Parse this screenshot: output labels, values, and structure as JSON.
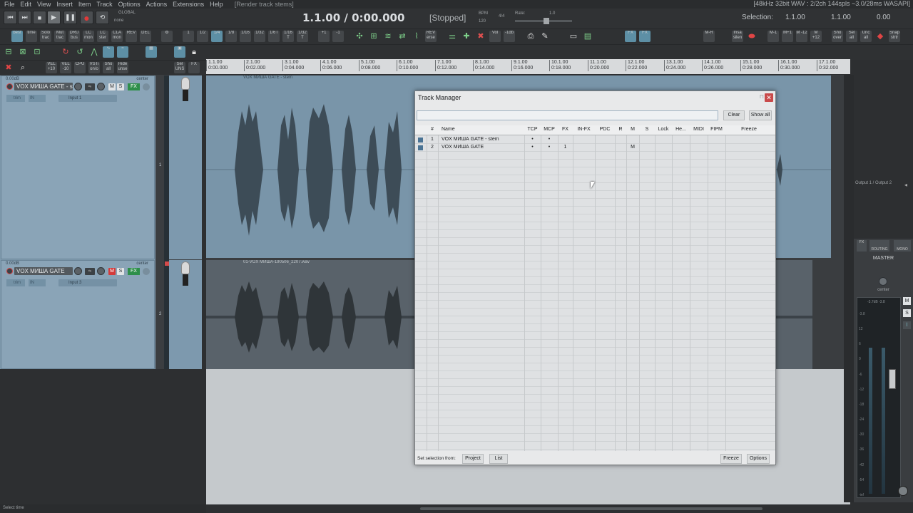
{
  "menubar": {
    "items": [
      "File",
      "Edit",
      "View",
      "Insert",
      "Item",
      "Track",
      "Options",
      "Actions",
      "Extensions",
      "Help"
    ],
    "window_title": "[Render track stems]",
    "project_info": "[48kHz 32bit WAV : 2/2ch 144spls ~3.0/28ms WASAPI]"
  },
  "transport": {
    "time": "1.1.00 / 0:00.000",
    "state": "[Stopped]",
    "bpm_label": "BPM",
    "bpm": "120",
    "signature": "4/4",
    "rate_label": "Rate:",
    "rate": "1.0",
    "global_label": "GLOBAL",
    "global_value": "none",
    "selection_label": "Selection:",
    "selection_start": "1.1.00",
    "selection_end": "1.1.00",
    "selection_length": "0.00"
  },
  "toolbar1": {
    "buttons": [
      "best",
      "time",
      "Solo trac",
      "Mut trac",
      "DRU bus",
      "LC mon",
      "LC ster",
      "CLA mon",
      "REV",
      "DEL"
    ],
    "grid": [
      "1",
      "1/2",
      "1/4",
      "1/8",
      "1/16",
      "1/32",
      "1/6T",
      "1/16 T",
      "1/32 T",
      "+1",
      "-1"
    ],
    "right_buttons": [
      "REV erse",
      "Vol",
      "-1db",
      "M-R",
      "Insa silen",
      "M-1",
      "M+1",
      "M -12",
      "M +12",
      "Sho over",
      "Sel all",
      "Unc all",
      "Snap strtr"
    ]
  },
  "toolbar2": {
    "buttons": [
      "VEL +10",
      "VEL -10",
      "CPU",
      "VSTi on/o",
      "Sho all",
      "Hide unse",
      "Sel UNS",
      "FX"
    ]
  },
  "ruler": {
    "marks": [
      {
        "bar": "1.1.00",
        "time": "0:00.000"
      },
      {
        "bar": "2.1.00",
        "time": "0:02.000"
      },
      {
        "bar": "3.1.00",
        "time": "0:04.000"
      },
      {
        "bar": "4.1.00",
        "time": "0:06.000"
      },
      {
        "bar": "5.1.00",
        "time": "0:08.000"
      },
      {
        "bar": "6.1.00",
        "time": "0:10.000"
      },
      {
        "bar": "7.1.00",
        "time": "0:12.000"
      },
      {
        "bar": "8.1.00",
        "time": "0:14.000"
      },
      {
        "bar": "9.1.00",
        "time": "0:16.000"
      },
      {
        "bar": "10.1.00",
        "time": "0:18.000"
      },
      {
        "bar": "11.1.00",
        "time": "0:20.000"
      },
      {
        "bar": "12.1.00",
        "time": "0:22.000"
      },
      {
        "bar": "13.1.00",
        "time": "0:24.000"
      },
      {
        "bar": "14.1.00",
        "time": "0:26.000"
      },
      {
        "bar": "15.1.00",
        "time": "0:28.000"
      },
      {
        "bar": "16.1.00",
        "time": "0:30.000"
      },
      {
        "bar": "17.1.00",
        "time": "0:32.000"
      }
    ]
  },
  "tracks": [
    {
      "vol": "0.00dB",
      "pan": "center",
      "name": "VOX МИША GATE - ste",
      "input": "Input 1",
      "trim": "trim",
      "in": "IN",
      "mute": "M",
      "solo": "S",
      "fx": "FX",
      "number": "1",
      "item_label": "VOX МИША GATE - stem"
    },
    {
      "vol": "0.00dB",
      "pan": "center",
      "name": "VOX МИША GATE",
      "input": "Input 3",
      "trim": "trim",
      "in": "IN",
      "mute": "M",
      "solo": "S",
      "fx": "FX",
      "number": "2",
      "item_label": "01-VOX МИША-190506_2207.wav"
    }
  ],
  "mixer": {
    "output_label": "Output 1 / Output 2",
    "master_label": "MASTER",
    "master_pan": "center",
    "master_peak": "-3.7dB",
    "routing_label": "ROUTING",
    "mono_label": "MONO",
    "fx_label": "FX",
    "scale": [
      "-3.8",
      "-3.8",
      "12",
      "6",
      "0",
      "-6",
      "-12",
      "-18",
      "-24",
      "-30",
      "-36",
      "-42",
      "-54",
      "-inf"
    ]
  },
  "status": {
    "text": "Select time"
  },
  "track_manager": {
    "title": "Track Manager",
    "filter_value": "",
    "clear_label": "Clear",
    "show_all_label": "Show all",
    "columns": [
      "#",
      "Name",
      "TCP",
      "MCP",
      "FX",
      "IN-FX",
      "PDC",
      "R",
      "M",
      "S",
      "Lock",
      "He...",
      "MIDI",
      "FIPM",
      "Freeze"
    ],
    "rows": [
      {
        "num": "1",
        "name": "VOX МИША GATE - stem",
        "tcp": "•",
        "mcp": "•",
        "fx": "",
        "m": ""
      },
      {
        "num": "2",
        "name": "VOX МИША GATE",
        "tcp": "•",
        "mcp": "•",
        "fx": "1",
        "m": "M"
      }
    ],
    "set_selection_label": "Set selection from:",
    "project_label": "Project",
    "list_label": "List",
    "freeze_label": "Freeze",
    "options_label": "Options"
  },
  "colors": {
    "accent": "#5d8fa5",
    "track": "#8aa4b7",
    "record": "#e03a3a",
    "fx_green": "#2e8f4a"
  }
}
